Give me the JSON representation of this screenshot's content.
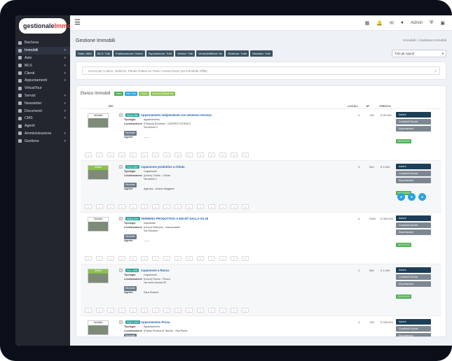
{
  "app": {
    "logo_main": "gestionale",
    "logo_accent": "Immobili"
  },
  "sidebar": {
    "items": [
      {
        "label": "Bacheca",
        "chevron": false,
        "active": false
      },
      {
        "label": "Immobili",
        "chevron": true,
        "active": true
      },
      {
        "label": "Aste",
        "chevron": true,
        "active": false
      },
      {
        "label": "MLS",
        "chevron": true,
        "active": false
      },
      {
        "label": "Clienti",
        "chevron": true,
        "active": false
      },
      {
        "label": "Appuntamenti",
        "chevron": true,
        "active": false
      },
      {
        "label": "VirtualTour",
        "chevron": false,
        "active": false
      },
      {
        "label": "Servizi",
        "chevron": true,
        "active": false
      },
      {
        "label": "Newsletter",
        "chevron": true,
        "active": false
      },
      {
        "label": "Documenti",
        "chevron": true,
        "active": false
      },
      {
        "label": "CMS",
        "chevron": true,
        "active": false
      },
      {
        "label": "Agenti",
        "chevron": false,
        "active": false
      },
      {
        "label": "Amministrazione",
        "chevron": true,
        "active": false
      },
      {
        "label": "Gestione",
        "chevron": true,
        "active": false
      }
    ]
  },
  "topbar": {
    "admin": "Admin"
  },
  "page": {
    "title": "Gestione Immobili",
    "breadcrumb_home": "Immobili",
    "breadcrumb_sep": ">",
    "breadcrumb_current": "Gestione Immobili",
    "filters": [
      "Stato: Attivi",
      "MLS: Tutti",
      "Pubblicazione: Online",
      "Esportazione: Tutti",
      "Vetrina: Tutti",
      "Venduti/Affittati: No",
      "Gestione: Tutte",
      "Mandato: Tutti"
    ],
    "agent_select": "Tutti gli Agenti",
    "search_placeholder": "Cerca per Codice, Indirizzo, Parole chiave su Titolo o Descrizione (es immobile Affitti)"
  },
  "list": {
    "title": "Elenco Immobili",
    "tags": [
      {
        "label": "Attivi",
        "color": "#4caf50"
      },
      {
        "label": "Mls Tutti",
        "color": "#29a3e5"
      },
      {
        "label": "Online",
        "color": "#8bc34a"
      },
      {
        "label": "Venduti/Affittati No",
        "color": "#8bc34a"
      }
    ],
    "columns": {
      "ric": "RIC",
      "locali": "LOCALI",
      "mq": "M²",
      "prezzo": "PREZZO"
    },
    "rows": [
      {
        "ribbon": "Vendita",
        "ref": "SUA-292",
        "title": "Appartamento indipendente con immenso terrazzo",
        "tipologia": "appartamento",
        "localizzazione": "(Padova) Bonarica - CENTRO STORICO",
        "indirizzo": "Via Arbolo 3",
        "agente": "-------",
        "locali": "4",
        "mq": "130",
        "prezzo": "€ 35.000",
        "date": "09/02/2023",
        "alt": false,
        "green": false
      },
      {
        "ribbon": "Affitto",
        "ref": "SLS-295",
        "title": "Capannone produttivo a Chiuto",
        "tipologia": "Capannone",
        "localizzazione": "(Lecco) Chiuto - Chiuto",
        "indirizzo": "Via abete 3",
        "agente": "Agenzia - Uranio Maggiore",
        "locali": "3",
        "mq": "540",
        "prezzo": "€ 2.500",
        "date": "16/02/2023",
        "alt": true,
        "green": true
      },
      {
        "ribbon": "Vendita",
        "ref": "NAQ-291",
        "title": "TERRENO PRODUTTIVO A 500 MT DALLA SS 36",
        "tipologia": "Industriale",
        "localizzazione": "(Lecco) Nibionno - mazzucarato",
        "indirizzo": "Via Rosdher",
        "agente": "-------",
        "locali": "0",
        "mq": "2900",
        "prezzo": "€ 280.000",
        "date": "16/01/2023",
        "alt": false,
        "green": false
      },
      {
        "ribbon": "Affitto",
        "ref": "SLL-298",
        "title": "Capannone a Ronco",
        "tipologia": "Capannone",
        "localizzazione": "(Lecco) Ronco - Ronco",
        "indirizzo": "via ronco boccia 25",
        "agente": "Sara Rosario",
        "locali": "2",
        "mq": "980",
        "prezzo": "€ 1.500",
        "date": "23/01/2023",
        "alt": true,
        "green": true
      },
      {
        "ribbon": "Vendita",
        "ref": "SQC-299",
        "title": "Appartamento Prosa",
        "tipologia": "Appartamento",
        "localizzazione": "(Pavia) Prosina di Tarchio - San Paolo",
        "indirizzo": "",
        "agente": "",
        "locali": "4",
        "mq": "135",
        "prezzo": "€ 335.000",
        "date": "",
        "alt": false,
        "green": false
      }
    ],
    "labels": {
      "tipologia": "Tipologia",
      "localizzazione": "Localizzazione",
      "agente": "Agente",
      "etichette": "Etichette",
      "azioni": "Azioni",
      "condividi": "Condividi Social",
      "esportazioni": "Esportazioni"
    }
  }
}
